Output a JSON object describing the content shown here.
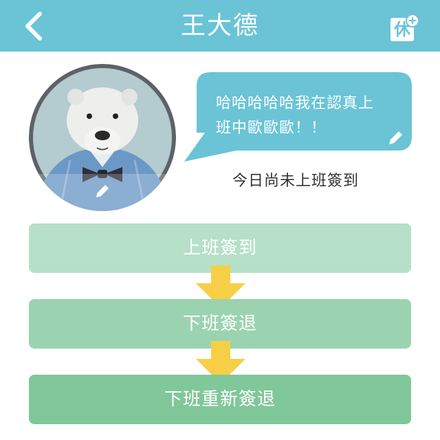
{
  "header": {
    "title": "王大德",
    "leave_label": "休"
  },
  "profile": {
    "message": "哈哈哈哈哈我在認真上班中歐歐歐！！",
    "status": "今日尚未上班簽到"
  },
  "actions": {
    "check_in": "上班簽到",
    "check_out": "下班簽退",
    "re_check_out": "下班重新簽退"
  },
  "colors": {
    "header": "#6ac4d6",
    "bubble": "#6ac4d6",
    "check_in": "#b6e0c7",
    "check_out": "#9bd3b0",
    "re_check_out": "#80c79a",
    "arrow": "#f7cf47"
  }
}
